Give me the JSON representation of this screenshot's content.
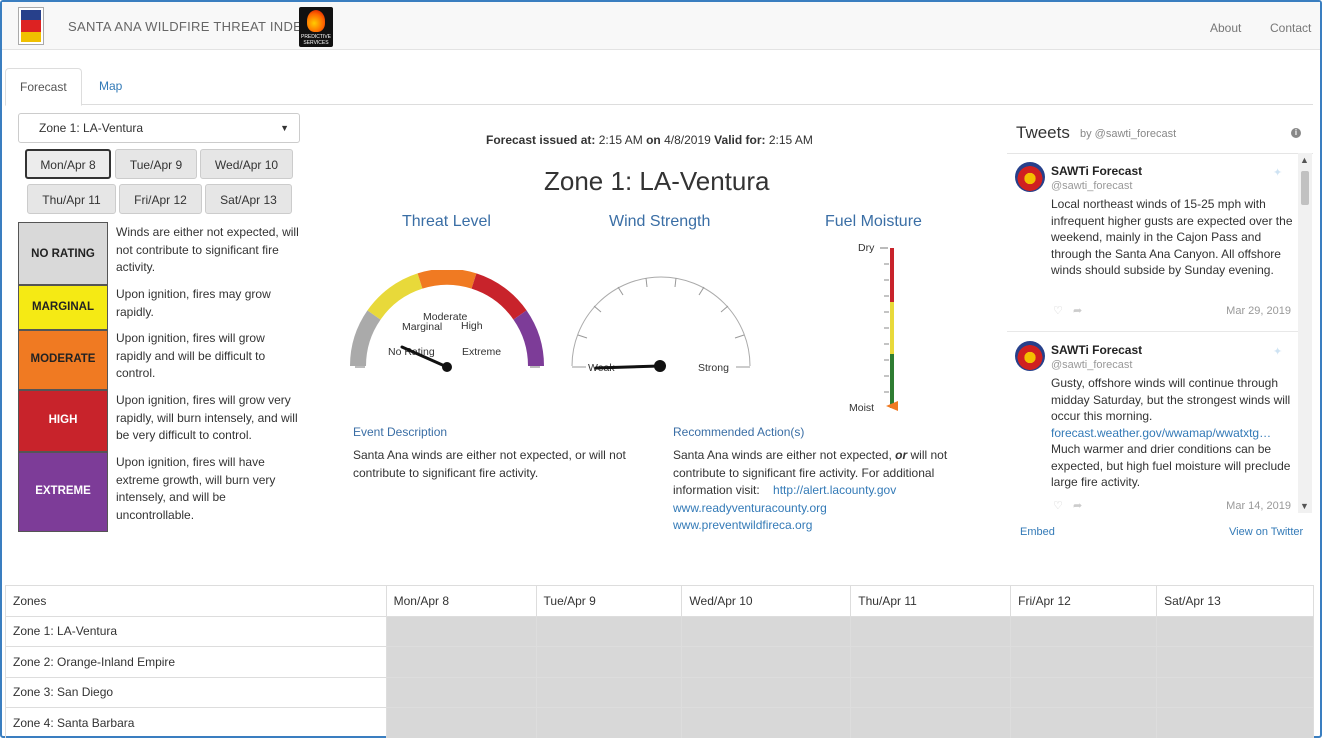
{
  "header": {
    "brand": "SANTA ANA WILDFIRE THREAT INDEX",
    "logo2_text": "PREDICTIVE SERVICES",
    "nav": [
      "About",
      "Contact"
    ]
  },
  "tabs": [
    {
      "label": "Forecast"
    },
    {
      "label": "Map"
    }
  ],
  "zone_select": {
    "value": "Zone 1: LA-Ventura"
  },
  "days": [
    "Mon/Apr 8",
    "Tue/Apr 9",
    "Wed/Apr 10",
    "Thu/Apr 11",
    "Fri/Apr 12",
    "Sat/Apr 13"
  ],
  "selected_day": "Mon/Apr 8",
  "legend": [
    {
      "label": "NO RATING",
      "color": "#d9d9d9",
      "desc": "Winds are either not expected, will not contribute to significant fire activity."
    },
    {
      "label": "MARGINAL",
      "color": "#f5ea14",
      "desc": "Upon ignition, fires may grow rapidly."
    },
    {
      "label": "MODERATE",
      "color": "#f07a22",
      "desc": "Upon ignition, fires will grow rapidly and will be difficult to control."
    },
    {
      "label": "HIGH",
      "color": "#c8232b",
      "desc": "Upon ignition, fires will grow very rapidly, will burn intensely, and will be very difficult to control."
    },
    {
      "label": "EXTREME",
      "color": "#7d3c98",
      "desc": "Upon ignition, fires will have extreme growth, will burn very intensely, and will be uncontrollable."
    }
  ],
  "forecast": {
    "issued_label": "Forecast issued at:",
    "issued_time": "2:15 AM",
    "on_label": "on",
    "issued_date": "4/8/2019",
    "valid_label": "Valid for:",
    "valid_time": "2:15 AM",
    "zone_title": "Zone 1: LA-Ventura"
  },
  "gauges": {
    "threat_title": "Threat Level",
    "wind_title": "Wind Strength",
    "fuel_title": "Fuel Moisture",
    "threat_labels": {
      "no_rating": "No Rating",
      "marginal": "Marginal",
      "moderate": "Moderate",
      "high": "High",
      "extreme": "Extreme"
    },
    "threat_value": "No Rating",
    "wind_labels": {
      "weak": "Weak",
      "strong": "Strong"
    },
    "wind_value": "Weak",
    "fuel_labels": {
      "dry": "Dry",
      "moist": "Moist"
    },
    "fuel_value": "Moist",
    "colors": {
      "gray": "#aaaaaa",
      "yellow": "#e8d93a",
      "orange": "#f07a22",
      "red": "#c8232b",
      "purple": "#7d3c98",
      "green": "#2e7d32"
    }
  },
  "event": {
    "heading": "Event Description",
    "text": "Santa Ana winds are either not expected, or will not contribute to significant fire activity."
  },
  "action": {
    "heading": "Recommended Action(s)",
    "text1": "Santa Ana winds are either not expected,",
    "or": "or",
    "text2": "will not contribute to significant fire activity. For additional information visit:",
    "links": [
      "http://alert.lacounty.gov",
      "www.readyventuracounty.org",
      "www.preventwildfireca.org"
    ]
  },
  "tweets": {
    "title": "Tweets",
    "by": "by @sawti_forecast",
    "items": [
      {
        "name": "SAWTi Forecast",
        "handle": "@sawti_forecast",
        "text": "Local northeast winds of 15-25 mph with infrequent higher gusts are expected over the weekend, mainly in the Cajon Pass and through the Santa Ana Canyon.  All offshore winds should subside by Sunday evening.",
        "link": "",
        "text_after": "",
        "date": "Mar 29, 2019"
      },
      {
        "name": "SAWTi Forecast",
        "handle": "@sawti_forecast",
        "text": "Gusty, offshore winds will continue through midday Saturday, but the strongest winds will occur this morning.",
        "link": "forecast.weather.gov/wwamap/wwatxtg…",
        "text_after": "Much warmer and drier conditions can be expected, but high fuel moisture will preclude large fire activity.",
        "date": "Mar 14, 2019"
      }
    ],
    "embed": "Embed",
    "view": "View on Twitter"
  },
  "table": {
    "columns": [
      "Zones",
      "Mon/Apr 8",
      "Tue/Apr 9",
      "Wed/Apr 10",
      "Thu/Apr 11",
      "Fri/Apr 12",
      "Sat/Apr 13"
    ],
    "rows": [
      "Zone 1: LA-Ventura",
      "Zone 2: Orange-Inland Empire",
      "Zone 3: San Diego",
      "Zone 4: Santa Barbara"
    ]
  }
}
